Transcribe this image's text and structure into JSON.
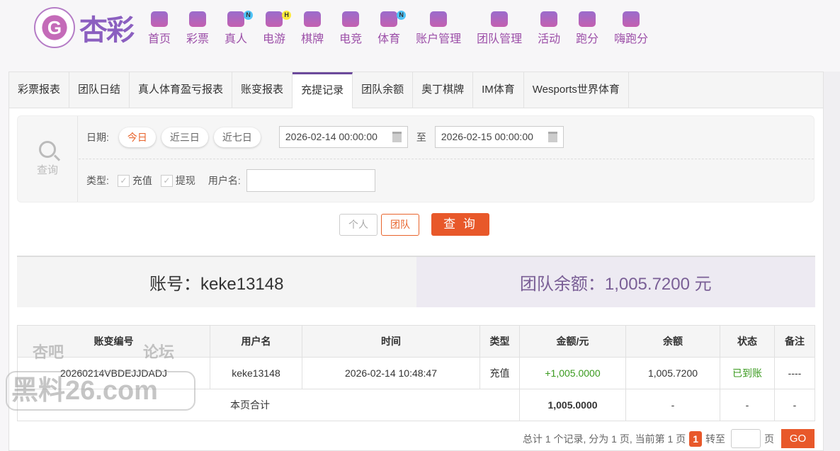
{
  "brand": {
    "logo_text": "杏彩",
    "logo_glyph": "G"
  },
  "nav": [
    {
      "label": "首页",
      "icon": "home-icon"
    },
    {
      "label": "彩票",
      "icon": "ticket-icon"
    },
    {
      "label": "真人",
      "icon": "dealer-icon",
      "badge": "N"
    },
    {
      "label": "电游",
      "icon": "gamepad-icon",
      "badge": "H"
    },
    {
      "label": "棋牌",
      "icon": "cards-icon"
    },
    {
      "label": "电竞",
      "icon": "gamepad-icon"
    },
    {
      "label": "体育",
      "icon": "trophy-icon",
      "badge": "N"
    },
    {
      "label": "账户管理",
      "icon": "yen-icon"
    },
    {
      "label": "团队管理",
      "icon": "team-icon"
    },
    {
      "label": "活动",
      "icon": "gift-icon"
    },
    {
      "label": "跑分",
      "icon": "rhino-icon"
    },
    {
      "label": "嗨跑分",
      "icon": "hi-icon"
    }
  ],
  "tabs": [
    "彩票报表",
    "团队日结",
    "真人体育盈亏报表",
    "账变报表",
    "充提记录",
    "团队余额",
    "奥丁棋牌",
    "IM体育",
    "Wesports世界体育"
  ],
  "active_tab": "充提记录",
  "filter": {
    "side_label": "查询",
    "date_label": "日期:",
    "quick": [
      "今日",
      "近三日",
      "近七日"
    ],
    "start": "2026-02-14 00:00:00",
    "to": "至",
    "end": "2026-02-15 00:00:00",
    "type_label": "类型:",
    "types": [
      "充值",
      "提现"
    ],
    "user_label": "用户名:",
    "user_value": "",
    "scope": [
      "个人",
      "团队"
    ],
    "query": "查 询"
  },
  "account": {
    "left": "账号：keke13148",
    "right": "团队余额：1,005.7200 元"
  },
  "table": {
    "headers": [
      "账变编号",
      "用户名",
      "时间",
      "类型",
      "金额/元",
      "余额",
      "状态",
      "备注"
    ],
    "rows": [
      [
        "20260214VBDEJJDADJ",
        "keke13148",
        "2026-02-14 10:48:47",
        "充值",
        "+1,005.0000",
        "1,005.7200",
        "已到账",
        "----"
      ]
    ],
    "total": {
      "label": "本页合计",
      "amount": "1,005.0000",
      "balance": "-",
      "status": "-",
      "note": "-"
    }
  },
  "pager": {
    "summary": "总计 1 个记录, 分为 1 页, 当前第 1 页",
    "current": "1",
    "goto": "转至",
    "page": "页",
    "go": "GO"
  },
  "watermark": {
    "top_left": "杏吧",
    "top_right": "论坛",
    "main": "黑料26.com"
  },
  "colors": {
    "accent": "#e8582a",
    "brand": "#9c4fa8",
    "success": "#3a9a1e"
  }
}
